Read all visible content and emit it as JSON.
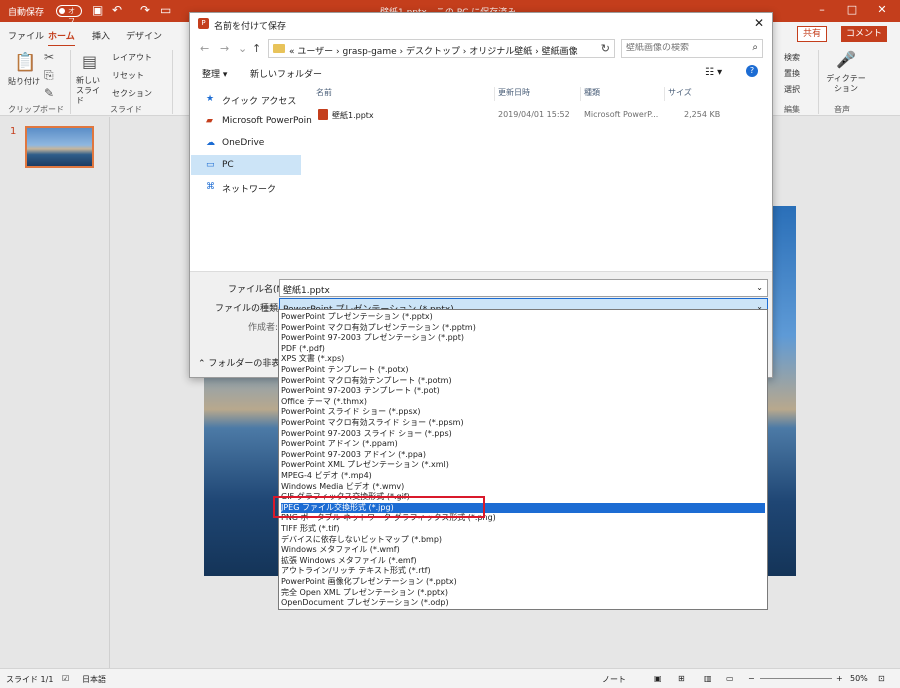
{
  "titlebar": {
    "autosave_label": "自動保存",
    "autosave_state": "オフ",
    "doc_title": "壁紙1.pptx - この PC に保存済み",
    "icons": [
      "save-icon",
      "undo-icon",
      "redo-icon",
      "slideshow-icon"
    ]
  },
  "ribbon_tabs": {
    "file": "ファイル",
    "home": "ホーム",
    "insert": "挿入",
    "design": "デザイン",
    "share": "共有",
    "comment": "コメント"
  },
  "ribbon": {
    "paste": "貼り付け",
    "clipboard_group": "クリップボード",
    "new_slide": "新しい スライド",
    "layout": "レイアウト",
    "reset": "リセット",
    "section": "セクション",
    "slides_group": "スライド",
    "find": "検索",
    "replace": "置換",
    "select": "選択",
    "editing_group": "編集",
    "dictate": "ディクテー ション",
    "voice_group": "音声"
  },
  "thumbs": {
    "number": "1"
  },
  "status": {
    "slide": "スライド 1/1",
    "lang": "日本語",
    "notes": "ノート",
    "zoom": "50%"
  },
  "dialog": {
    "title": "名前を付けて保存",
    "path": "« ユーザー › grasp-game › デスクトップ › オリジナル壁紙 › 壁紙画像",
    "search_placeholder": "壁紙画像の検索",
    "organize": "整理 ▾",
    "new_folder": "新しいフォルダー",
    "nav": [
      {
        "label": "クイック アクセス",
        "icon": "star-icon"
      },
      {
        "label": "Microsoft PowerPoin",
        "icon": "powerpoint-icon"
      },
      {
        "label": "OneDrive",
        "icon": "cloud-icon"
      },
      {
        "label": "PC",
        "icon": "pc-icon"
      },
      {
        "label": "ネットワーク",
        "icon": "network-icon"
      }
    ],
    "columns": {
      "name": "名前",
      "date": "更新日時",
      "type": "種類",
      "size": "サイズ"
    },
    "file": {
      "name": "壁紙1.pptx",
      "date": "2019/04/01 15:52",
      "type": "Microsoft PowerP...",
      "size": "2,254 KB"
    },
    "filename_label": "ファイル名(N):",
    "filename_value": "壁紙1.pptx",
    "filetype_label": "ファイルの種類(T):",
    "filetype_value": "PowerPoint プレゼンテーション (*.pptx)",
    "author_label": "作成者:",
    "hide_folders": "フォルダーの非表示"
  },
  "filetype_options": [
    "PowerPoint プレゼンテーション (*.pptx)",
    "PowerPoint マクロ有効プレゼンテーション (*.pptm)",
    "PowerPoint 97-2003 プレゼンテーション (*.ppt)",
    "PDF (*.pdf)",
    "XPS 文書 (*.xps)",
    "PowerPoint テンプレート (*.potx)",
    "PowerPoint マクロ有効テンプレート (*.potm)",
    "PowerPoint 97-2003 テンプレート (*.pot)",
    "Office テーマ (*.thmx)",
    "PowerPoint スライド ショー (*.ppsx)",
    "PowerPoint マクロ有効スライド ショー (*.ppsm)",
    "PowerPoint 97-2003 スライド ショー (*.pps)",
    "PowerPoint アドイン (*.ppam)",
    "PowerPoint 97-2003 アドイン (*.ppa)",
    "PowerPoint XML プレゼンテーション (*.xml)",
    "MPEG-4 ビデオ (*.mp4)",
    "Windows Media ビデオ (*.wmv)",
    "GIF グラフィックス交換形式 (*.gif)",
    "JPEG ファイル交換形式 (*.jpg)",
    "PNG ポータブル ネットワーク グラフィックス形式 (*.png)",
    "TIFF 形式 (*.tif)",
    "デバイスに依存しないビットマップ (*.bmp)",
    "Windows メタファイル (*.wmf)",
    "拡張 Windows メタファイル (*.emf)",
    "アウトライン/リッチ テキスト形式 (*.rtf)",
    "PowerPoint 画像化プレゼンテーション (*.pptx)",
    "完全 Open XML プレゼンテーション (*.pptx)",
    "OpenDocument プレゼンテーション (*.odp)"
  ],
  "selected_option_index": 18,
  "colors": {
    "accent": "#c43e1c",
    "selection": "#1c6cd3",
    "highlight_box": "#d9192b"
  }
}
